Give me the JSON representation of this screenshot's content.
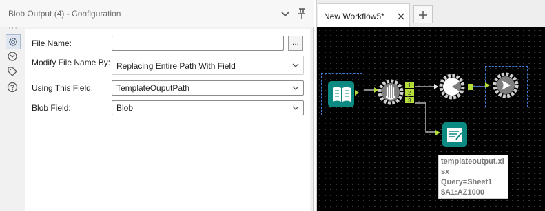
{
  "config": {
    "title": "Blob Output (4) - Configuration",
    "icons": {
      "collapse": "chevron-down-icon",
      "pin": "pin-icon"
    },
    "side_icons": [
      "gear-icon",
      "connection-icon",
      "tag-icon",
      "help-icon"
    ],
    "fields": {
      "file_name": {
        "label": "File Name:",
        "value": "",
        "browse_label": "..."
      },
      "modify": {
        "label": "Modify File Name By:",
        "value": "Replacing Entire Path With Field"
      },
      "using": {
        "label": "Using This Field:",
        "value": "TemplateOuputPath"
      },
      "blob": {
        "label": "Blob Field:",
        "value": "Blob"
      }
    }
  },
  "workflow": {
    "tab_label": "New Workflow5*",
    "tools": [
      "input-data-tool",
      "message-tool",
      "join-tool",
      "blob-output-tool",
      "output-data-tool"
    ],
    "anchors": {
      "anchor1": "1",
      "anchor2": "2",
      "anchor3": "3"
    },
    "tooltip": {
      "line1": "templateoutput.xl",
      "line2": "sx",
      "line3": "Query=Sheet1",
      "line4": "$A1:AZ1000"
    },
    "colors": {
      "canvas": "#000000",
      "tool_teal": "#0c8a82",
      "gear_gray": "#cfcfcf",
      "anchor_lime": "#b5dd3a",
      "selection": "#3c7dd9"
    }
  }
}
